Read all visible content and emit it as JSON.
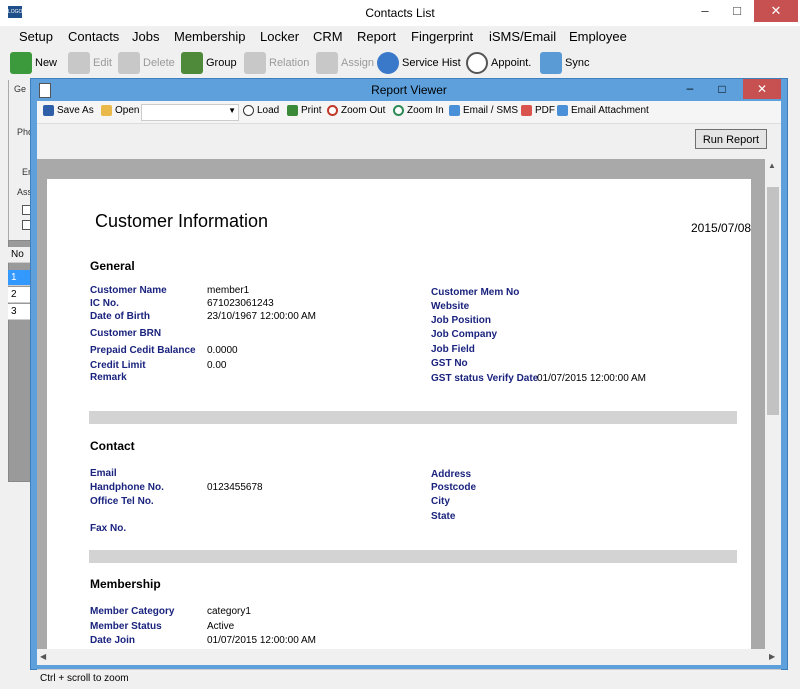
{
  "main_window": {
    "title": "Contacts List",
    "app_icon": "app-logo-icon",
    "menu": [
      "Setup",
      "Contacts",
      "Jobs",
      "Membership",
      "Locker",
      "CRM",
      "Report",
      "Fingerprint",
      "iSMS/Email",
      "Employee"
    ],
    "toolbar": {
      "new": "New",
      "edit": "Edit",
      "delete": "Delete",
      "group": "Group",
      "relation": "Relation",
      "assign": "Assign",
      "service_hist": "Service Hist",
      "appoint": "Appoint.",
      "sync": "Sync"
    },
    "left_fragments": [
      "Ge",
      "Pho",
      "Er",
      "Ass"
    ],
    "grid": {
      "header": "No",
      "rows": [
        "1",
        "2",
        "3"
      ]
    }
  },
  "report_viewer": {
    "title": "Report Viewer",
    "toolbar": {
      "save_as": "Save As",
      "open": "Open",
      "load": "Load",
      "print": "Print",
      "zoom_out": "Zoom Out",
      "zoom_in": "Zoom In",
      "email_sms": "Email / SMS",
      "pdf": "PDF",
      "email_attachment": "Email Attachment"
    },
    "run_report": "Run Report",
    "status": "Ctrl + scroll to zoom",
    "report": {
      "title": "Customer Information",
      "date": "2015/07/08",
      "general": {
        "heading": "General",
        "customer_name_label": "Customer Name",
        "customer_name": "member1",
        "ic_label": "IC No.",
        "ic": "671023061243",
        "dob_label": "Date of Birth",
        "dob": "23/10/1967 12:00:00 AM",
        "brn_label": "Customer BRN",
        "prepaid_label": "Prepaid Cedit Balance",
        "prepaid": "0.0000",
        "credit_label": "Credit Limit",
        "credit": "0.00",
        "remark_label": "Remark",
        "mem_no_label": "Customer Mem No",
        "website_label": "Website",
        "job_position_label": "Job Position",
        "job_company_label": "Job Company",
        "job_field_label": "Job Field",
        "gst_label": "GST No",
        "gst_verify_label": "GST status Verify Date",
        "gst_verify": "01/07/2015 12:00:00 AM"
      },
      "contact": {
        "heading": "Contact",
        "email_label": "Email",
        "handphone_label": "Handphone No.",
        "handphone": "0123455678",
        "office_label": "Office Tel No.",
        "fax_label": "Fax No.",
        "address_label": "Address",
        "postcode_label": "Postcode",
        "city_label": "City",
        "state_label": "State"
      },
      "membership": {
        "heading": "Membership",
        "category_label": "Member Category",
        "category": "category1",
        "status_label": "Member Status",
        "status": "Active",
        "join_label": "Date Join",
        "join": "01/07/2015 12:00:00 AM"
      }
    }
  }
}
